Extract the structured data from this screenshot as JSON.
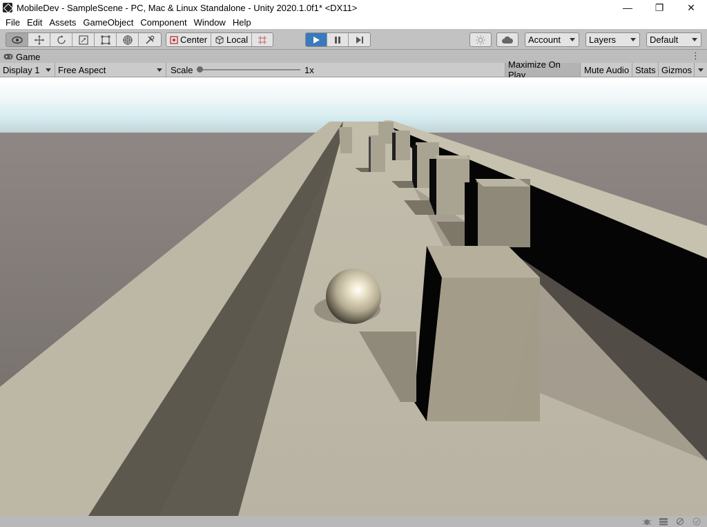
{
  "window": {
    "title": "MobileDev - SampleScene - PC, Mac & Linux Standalone - Unity 2020.1.0f1* <DX11>",
    "minimize_glyph": "—",
    "maximize_glyph": "❐",
    "close_glyph": "✕"
  },
  "menu": {
    "items": [
      "File",
      "Edit",
      "Assets",
      "GameObject",
      "Component",
      "Window",
      "Help"
    ]
  },
  "toolbar": {
    "tools": [
      {
        "icon": "view-eye-icon",
        "glyph": "👁",
        "active": true
      },
      {
        "icon": "move-tool-icon",
        "glyph": "✥"
      },
      {
        "icon": "rotate-tool-icon",
        "glyph": "↻"
      },
      {
        "icon": "scale-tool-icon",
        "glyph": "⤢"
      },
      {
        "icon": "rect-tool-icon",
        "glyph": "▭"
      },
      {
        "icon": "transform-tool-icon",
        "glyph": "⊕"
      },
      {
        "icon": "custom-tool-icon",
        "glyph": "✂"
      }
    ],
    "pivot_label": "Center",
    "space_label": "Local",
    "account_label": "Account",
    "layers_label": "Layers",
    "layout_label": "Default"
  },
  "game_tab": {
    "label": "Game"
  },
  "game_bar": {
    "display_label": "Display 1",
    "aspect_label": "Free Aspect",
    "scale_label": "Scale",
    "scale_value": "1x",
    "scale_slider_fraction": 0.0,
    "maximize_label": "Maximize On Play",
    "mute_label": "Mute Audio",
    "stats_label": "Stats",
    "gizmos_label": "Gizmos"
  },
  "colors": {
    "play_active": "#3a79bb",
    "sky_top": "#ffffff",
    "horizon": "#8b8480",
    "ground": "#7a7470",
    "track": "#b9b3a3",
    "wall_top": "#bdb7a6",
    "wall_side": "#625e52",
    "shadow": "#000000"
  }
}
